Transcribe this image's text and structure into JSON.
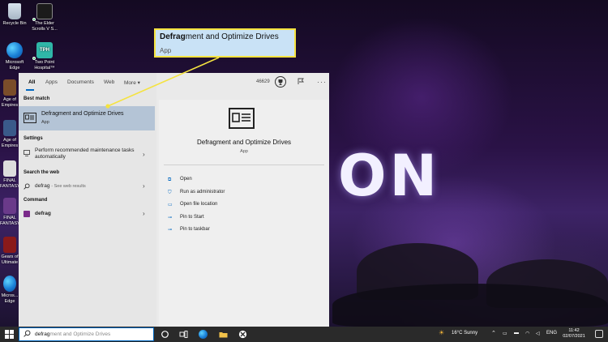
{
  "desktop": {
    "icons": [
      {
        "label": "Recycle Bin"
      },
      {
        "label": "The Elder Scrolls V S..."
      },
      {
        "label": "Microsoft Edge"
      },
      {
        "label": "Two Point Hospital™"
      },
      {
        "label": "Age of Empires"
      },
      {
        "label": "Age of Empires"
      },
      {
        "label": "FINAL FANTASY"
      },
      {
        "label": "FINAL FANTASY"
      },
      {
        "label": "Gears of Ultimate"
      },
      {
        "label": "Micros... Edge"
      }
    ],
    "wallpaper_text": "ON"
  },
  "search": {
    "tabs": [
      {
        "label": "All"
      },
      {
        "label": "Apps"
      },
      {
        "label": "Documents"
      },
      {
        "label": "Web"
      },
      {
        "label": "More ▾"
      }
    ],
    "points": "46629",
    "best_match": {
      "section": "Best match",
      "title": "Defragment and Optimize Drives",
      "subtitle": "App"
    },
    "settings": {
      "section": "Settings",
      "item": "Perform recommended maintenance tasks automatically"
    },
    "web": {
      "section": "Search the web",
      "query": "defrag",
      "suffix": "- See web results"
    },
    "command": {
      "section": "Command",
      "item": "defrag"
    },
    "detail": {
      "title": "Defragment and Optimize Drives",
      "subtitle": "App",
      "actions": [
        {
          "label": "Open"
        },
        {
          "label": "Run as administrator"
        },
        {
          "label": "Open file location"
        },
        {
          "label": "Pin to Start"
        },
        {
          "label": "Pin to taskbar"
        }
      ]
    }
  },
  "callout": {
    "bold": "Defrag",
    "rest": "ment and Optimize Drives",
    "subtitle": "App"
  },
  "taskbar": {
    "search_typed": "defrag",
    "search_ghost": "ment and Optimize Drives",
    "weather": "16°C  Sunny",
    "language": "ENG",
    "time": "11:42",
    "date": "02/07/2021"
  },
  "colors": {
    "accent": "#0067c0",
    "callout_border": "#f5e340",
    "selection": "#b4c4d6"
  }
}
